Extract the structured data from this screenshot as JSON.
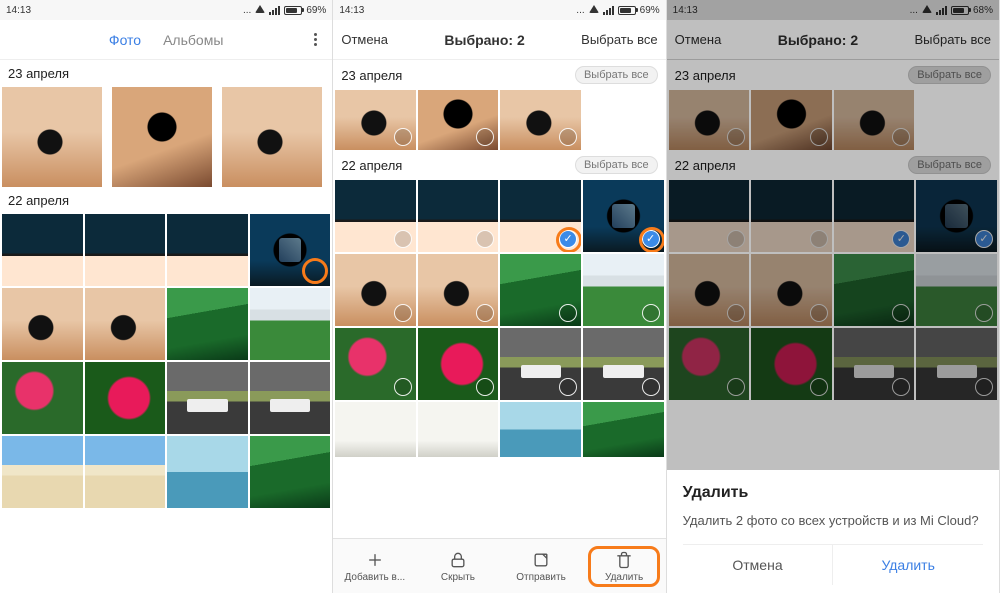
{
  "status": {
    "time": "14:13",
    "battery_pct_main": "69%",
    "battery_pct_right": "68%"
  },
  "panel1": {
    "tab_photos": "Фото",
    "tab_albums": "Альбомы",
    "section_apr23": "23 апреля",
    "section_apr22": "22 апреля"
  },
  "panel2": {
    "cancel": "Отмена",
    "title": "Выбрано: 2",
    "select_all": "Выбрать все",
    "section_apr23": "23 апреля",
    "section_sel_all": "Выбрать все",
    "section_apr22": "22 апреля",
    "bb_add": "Добавить в...",
    "bb_hide": "Скрыть",
    "bb_send": "Отправить",
    "bb_delete": "Удалить"
  },
  "panel3": {
    "cancel": "Отмена",
    "title": "Выбрано: 2",
    "select_all": "Выбрать все",
    "section_apr23": "23 апреля",
    "section_sel_all": "Выбрать все",
    "section_apr22": "22 апреля",
    "dialog_title": "Удалить",
    "dialog_body": "Удалить 2 фото со всех устройств и из Mi Cloud?",
    "dialog_cancel": "Отмена",
    "dialog_confirm": "Удалить"
  }
}
